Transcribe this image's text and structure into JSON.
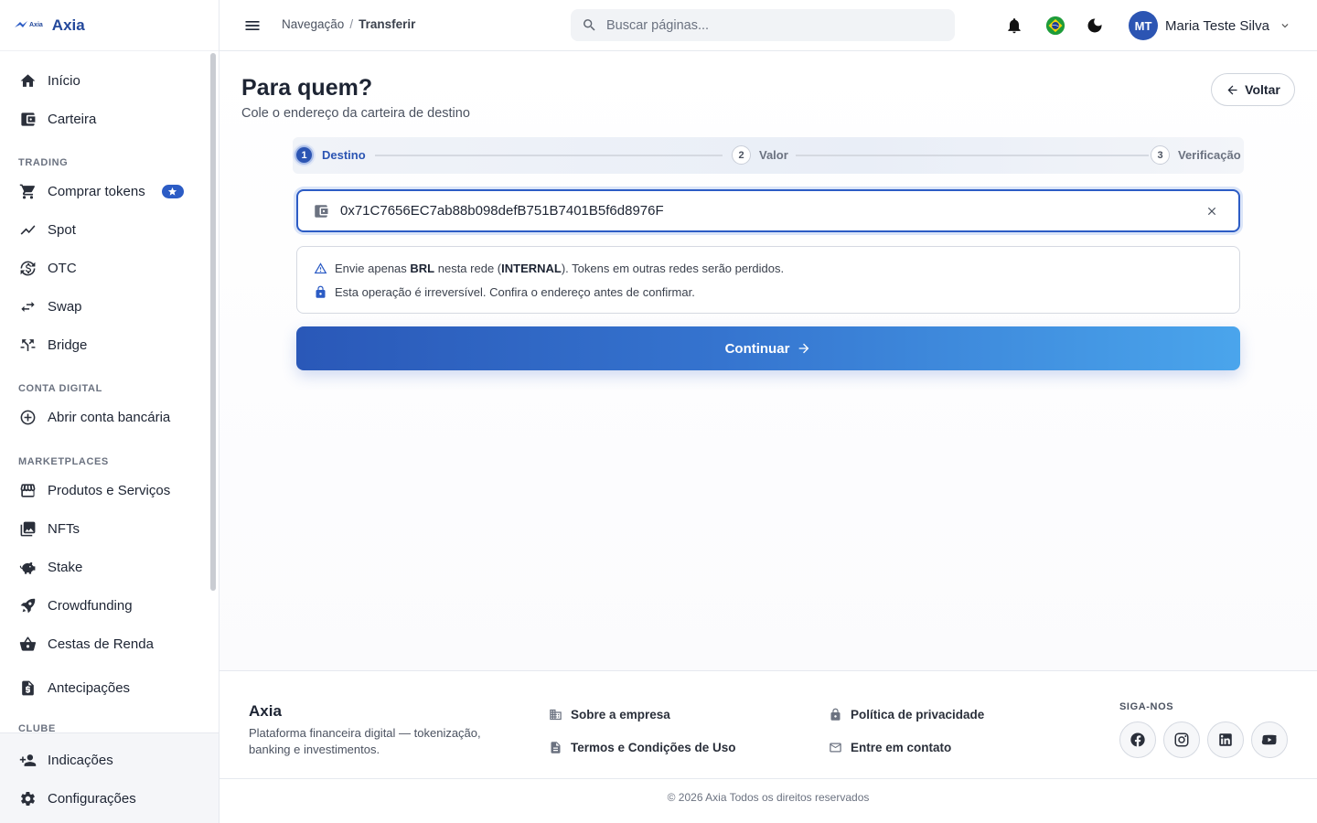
{
  "brand": {
    "mini_word": "Axia",
    "name": "Axia"
  },
  "sidebar": {
    "items_top": [
      {
        "label": "Início",
        "icon": "home-icon"
      },
      {
        "label": "Carteira",
        "icon": "wallet-icon"
      }
    ],
    "trading_label": "TRADING",
    "trading_items": [
      {
        "label": "Comprar tokens",
        "icon": "cart-icon",
        "badge": "star-icon"
      },
      {
        "label": "Spot",
        "icon": "trending-icon"
      },
      {
        "label": "OTC",
        "icon": "currency-exchange-icon"
      },
      {
        "label": "Swap",
        "icon": "swap-icon"
      },
      {
        "label": "Bridge",
        "icon": "bridge-icon"
      }
    ],
    "digital_label": "CONTA DIGITAL",
    "digital_items": [
      {
        "label": "Abrir conta bancária",
        "icon": "add-circle-icon"
      }
    ],
    "market_label": "MARKETPLACES",
    "market_items": [
      {
        "label": "Produtos e Serviços",
        "icon": "store-icon"
      },
      {
        "label": "NFTs",
        "icon": "image-icon"
      },
      {
        "label": "Stake",
        "icon": "piggy-bank-icon"
      },
      {
        "label": "Crowdfunding",
        "icon": "rocket-icon"
      },
      {
        "label": "Cestas de Renda",
        "icon": "basket-icon"
      }
    ],
    "extra_items": [
      {
        "label": "Antecipações",
        "icon": "receipt-icon"
      }
    ],
    "club_label": "CLUBE",
    "bottom_items": [
      {
        "label": "Indicações",
        "icon": "person-add-icon"
      },
      {
        "label": "Configurações",
        "icon": "gear-icon"
      }
    ]
  },
  "header": {
    "breadcrumb_root": "Navegação",
    "breadcrumb_sep": "/",
    "breadcrumb_current": "Transferir",
    "search_placeholder": "Buscar páginas...",
    "user_initials": "MT",
    "user_name": "Maria Teste Silva"
  },
  "main": {
    "title": "Para quem?",
    "subtitle": "Cole o endereço da carteira de destino",
    "back_label": "Voltar",
    "steps": [
      {
        "num": "1",
        "label": "Destino",
        "active": true
      },
      {
        "num": "2",
        "label": "Valor",
        "active": false
      },
      {
        "num": "3",
        "label": "Verificação",
        "active": false
      }
    ],
    "address_value": "0x71C7656EC7ab88b098defB751B7401B5f6d8976F",
    "notice": {
      "line1_a": "Envie apenas ",
      "line1_token": "BRL",
      "line1_b": " nesta rede (",
      "line1_network": "INTERNAL",
      "line1_c": "). Tokens em outras redes serão perdidos.",
      "line2": "Esta operação é irreversível. Confira o endereço antes de confirmar."
    },
    "continue_label": "Continuar"
  },
  "footer": {
    "brand": "Axia",
    "description": "Plataforma financeira digital — tokenização, banking e investimentos.",
    "links": {
      "about": "Sobre a empresa",
      "terms": "Termos e Condições de Uso",
      "privacy": "Política de privacidade",
      "contact": "Entre em contato"
    },
    "follow_label": "SIGA-NOS",
    "copyright": "© 2026 Axia Todos os direitos reservados"
  },
  "colors": {
    "accent": "#2c5cc5",
    "accent_light": "#4aa5ec",
    "text": "#1d2433"
  }
}
